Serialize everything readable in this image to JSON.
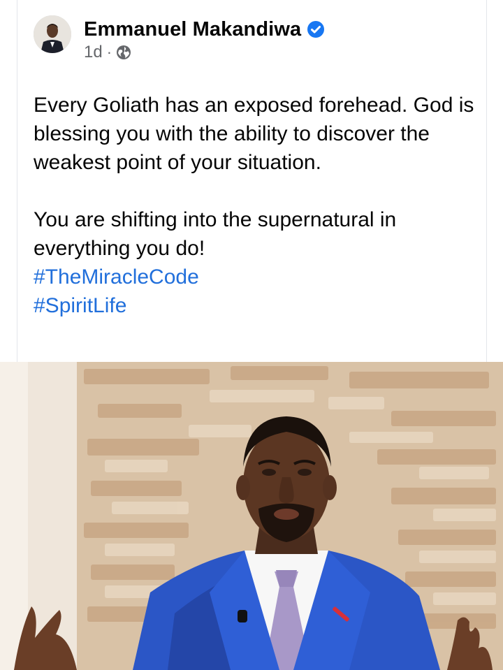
{
  "author": {
    "name": "Emmanuel Makandiwa",
    "verified_icon": "verified-badge-icon",
    "post_time": "1d",
    "separator": "·",
    "audience_icon": "globe-icon"
  },
  "post": {
    "paragraph1": "Every Goliath has an exposed forehead. God is blessing you with the ability to discover the weakest point of your situation.",
    "paragraph2": "You are shifting into the supernatural in everything you do!",
    "hashtags": [
      "#TheMiracleCode",
      "#SpiritLife"
    ]
  },
  "photo": {
    "subject": "man in blue suit with lavender tie in front of stone wall"
  },
  "colors": {
    "hashtag": "#216fdb",
    "verified": "#1877f2",
    "meta": "#65676b",
    "suit": "#2b56c6"
  }
}
